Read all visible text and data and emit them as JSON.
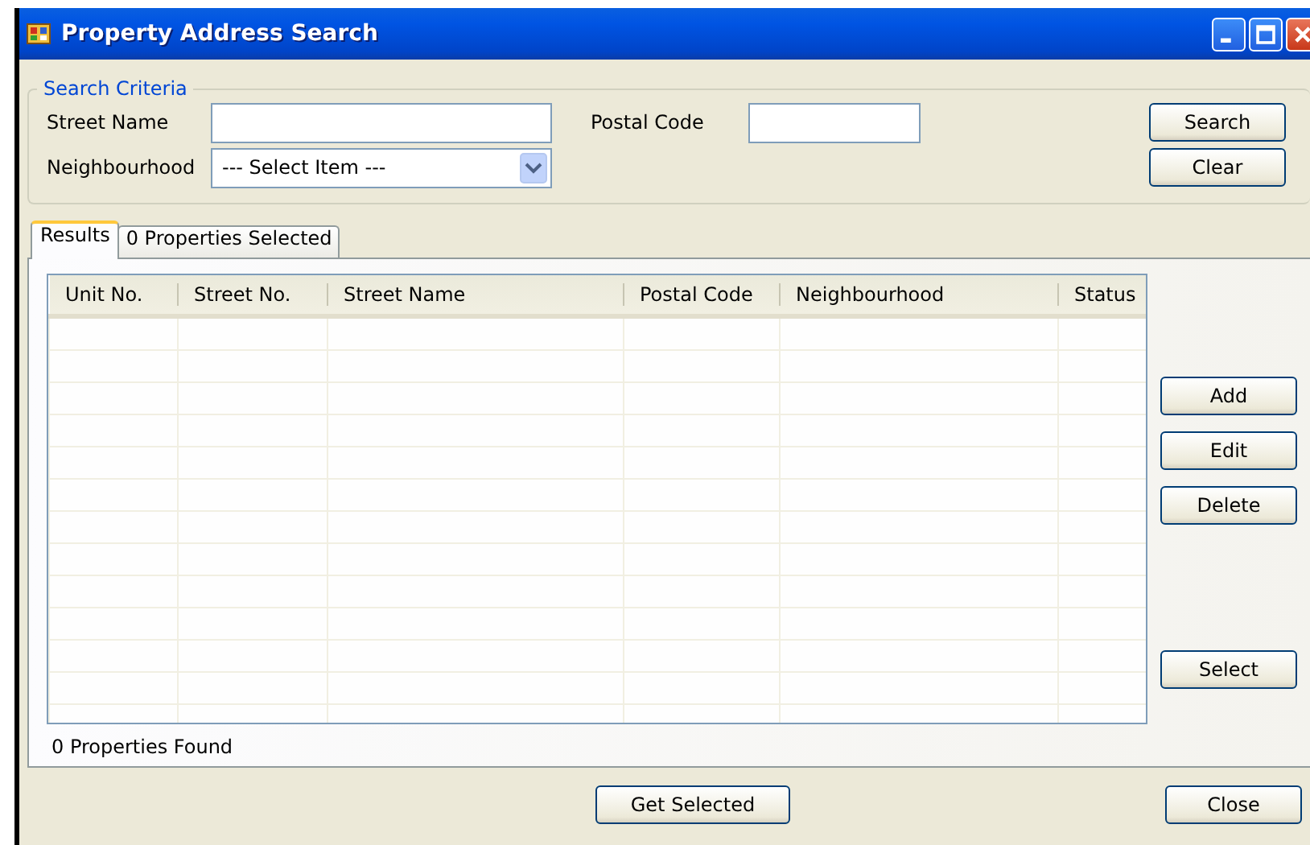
{
  "window": {
    "title": "Property Address Search"
  },
  "search_criteria": {
    "title": "Search Criteria",
    "street_name": {
      "label": "Street Name"
    },
    "postal_code": {
      "label": "Postal Code"
    },
    "neighbourhood": {
      "label": "Neighbourhood",
      "value": "--- Select Item ---"
    },
    "buttons": [
      "Search",
      "Clear"
    ]
  },
  "tabs": [
    {
      "label": "Results",
      "selected": true
    },
    {
      "label": "0 Properties Selected",
      "selected": false
    }
  ],
  "table": {
    "columns": [
      "Unit No.",
      "Street No.",
      "Street Name",
      "Postal Code",
      "Neighbourhood",
      "Status"
    ]
  },
  "side_buttons": [
    "Add",
    "Edit",
    "Delete",
    "Select"
  ],
  "status": "0 Properties Found",
  "footer_buttons": [
    "Get Selected",
    "Close"
  ]
}
